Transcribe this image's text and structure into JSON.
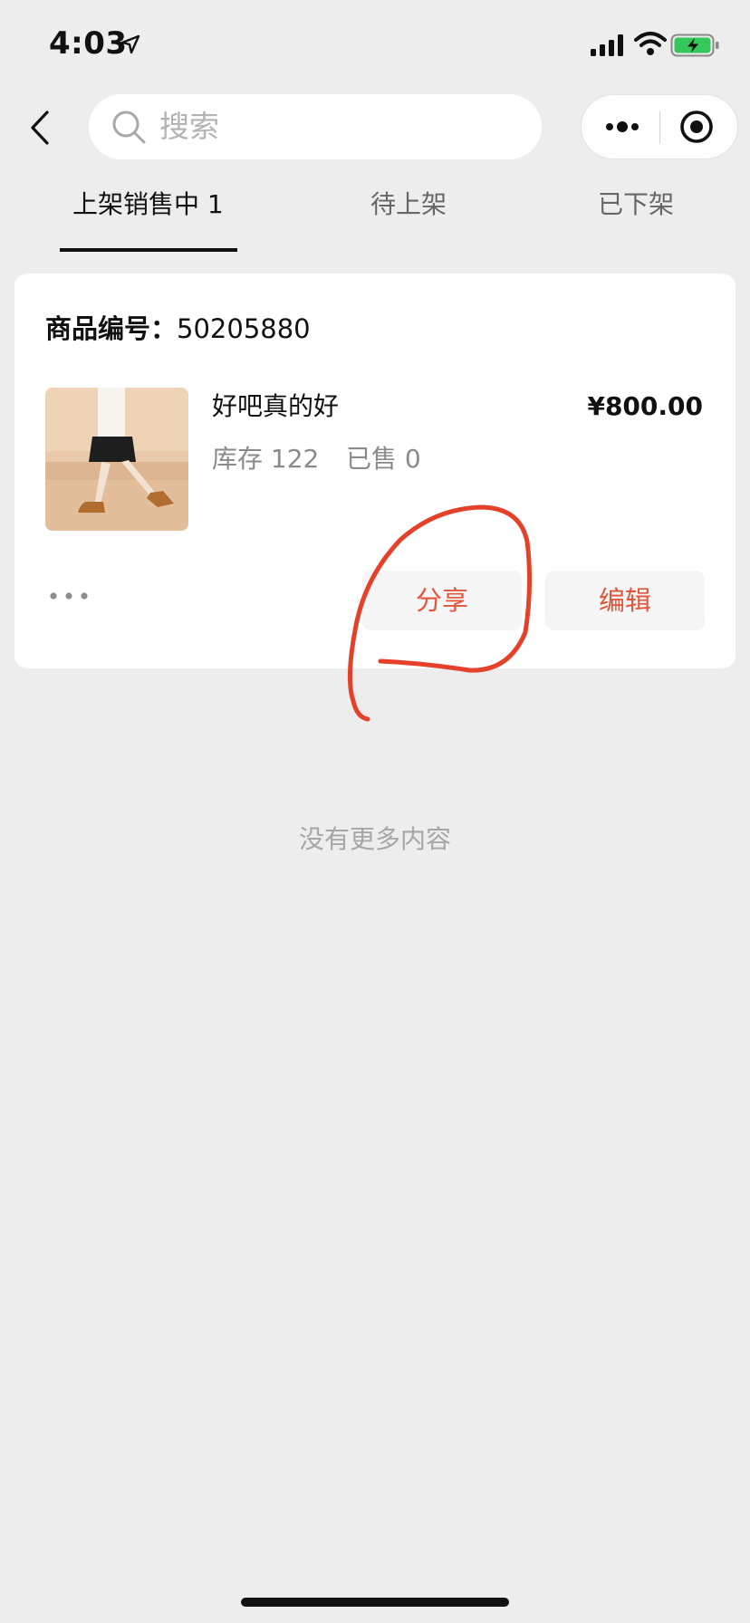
{
  "status_bar": {
    "time": "4:03"
  },
  "search": {
    "placeholder": "搜索"
  },
  "tabs": [
    {
      "label": "上架销售中 1",
      "active": true
    },
    {
      "label": "待上架",
      "active": false
    },
    {
      "label": "已下架",
      "active": false
    }
  ],
  "product": {
    "code_label": "商品编号：",
    "code": "50205880",
    "title": "好吧真的好",
    "price": "¥800.00",
    "stock": "库存 122",
    "sold": "已售 0",
    "actions": {
      "share": "分享",
      "edit": "编辑"
    }
  },
  "footer_text": "没有更多内容",
  "colors": {
    "accent": "#e4543a",
    "annotation": "#e5402a",
    "background": "#ededed"
  },
  "icons": [
    "location-arrow-icon",
    "signal-icon",
    "wifi-icon",
    "battery-charging-icon",
    "back-icon",
    "search-icon",
    "more-icon",
    "close-miniprogram-icon",
    "dots-icon"
  ]
}
